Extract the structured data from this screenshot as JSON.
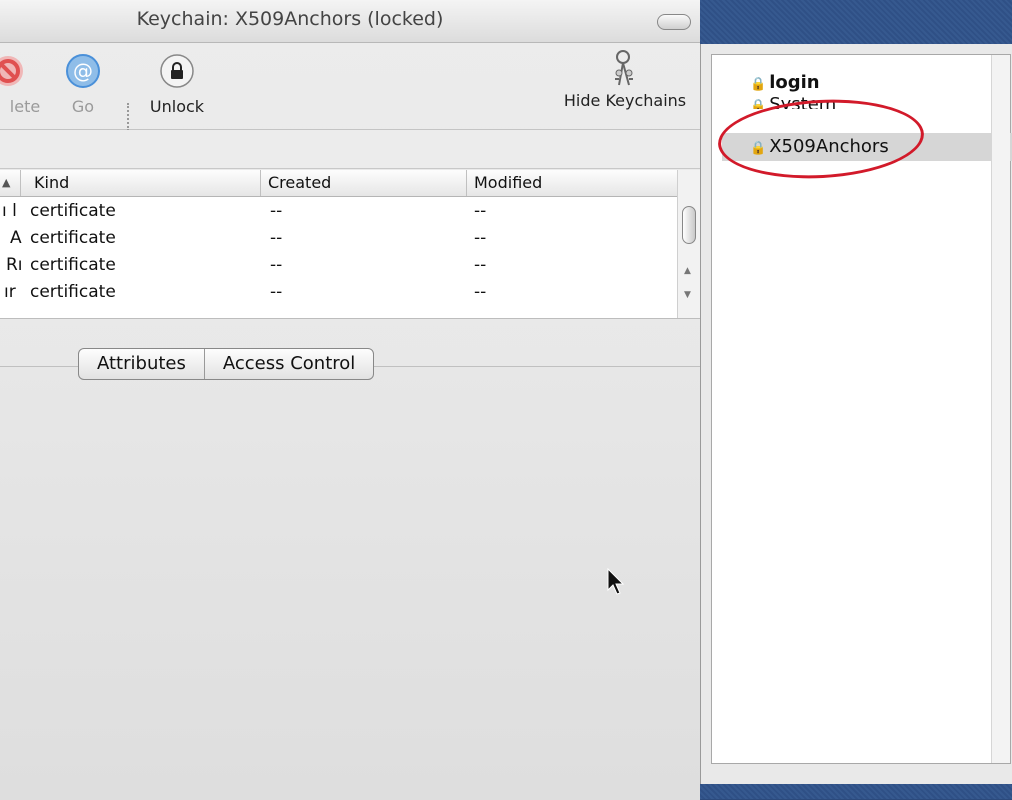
{
  "window": {
    "title": "Keychain: X509Anchors (locked)"
  },
  "toolbar": {
    "delete_label": "lete",
    "go_label": "Go",
    "unlock_label": "Unlock",
    "hide_keychains_label": "Hide Keychains"
  },
  "table": {
    "headers": {
      "kind": "Kind",
      "created": "Created",
      "modified": "Modified"
    },
    "rows": [
      {
        "prefix": "ı l",
        "kind": "certificate",
        "created": "--",
        "modified": "--"
      },
      {
        "prefix": "A",
        "kind": "certificate",
        "created": "--",
        "modified": "--"
      },
      {
        "prefix": "Rı",
        "kind": "certificate",
        "created": "--",
        "modified": "--"
      },
      {
        "prefix": "ır",
        "kind": "certificate",
        "created": "--",
        "modified": "--"
      }
    ]
  },
  "tabs": {
    "attributes": "Attributes",
    "access_control": "Access Control"
  },
  "keychains": [
    {
      "name": "login"
    },
    {
      "name": "System"
    },
    {
      "name": "X509Anchors"
    }
  ],
  "colors": {
    "highlight_circle": "#d21a2a",
    "go_icon": "#4a90d9",
    "delete_icon": "#e05050"
  }
}
